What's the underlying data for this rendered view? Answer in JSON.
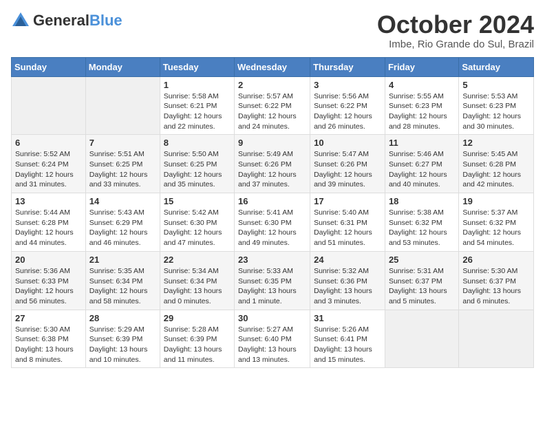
{
  "logo": {
    "text_general": "General",
    "text_blue": "Blue"
  },
  "header": {
    "month": "October 2024",
    "location": "Imbe, Rio Grande do Sul, Brazil"
  },
  "days_of_week": [
    "Sunday",
    "Monday",
    "Tuesday",
    "Wednesday",
    "Thursday",
    "Friday",
    "Saturday"
  ],
  "weeks": [
    [
      {
        "day": "",
        "info": ""
      },
      {
        "day": "",
        "info": ""
      },
      {
        "day": "1",
        "info": "Sunrise: 5:58 AM\nSunset: 6:21 PM\nDaylight: 12 hours and 22 minutes."
      },
      {
        "day": "2",
        "info": "Sunrise: 5:57 AM\nSunset: 6:22 PM\nDaylight: 12 hours and 24 minutes."
      },
      {
        "day": "3",
        "info": "Sunrise: 5:56 AM\nSunset: 6:22 PM\nDaylight: 12 hours and 26 minutes."
      },
      {
        "day": "4",
        "info": "Sunrise: 5:55 AM\nSunset: 6:23 PM\nDaylight: 12 hours and 28 minutes."
      },
      {
        "day": "5",
        "info": "Sunrise: 5:53 AM\nSunset: 6:23 PM\nDaylight: 12 hours and 30 minutes."
      }
    ],
    [
      {
        "day": "6",
        "info": "Sunrise: 5:52 AM\nSunset: 6:24 PM\nDaylight: 12 hours and 31 minutes."
      },
      {
        "day": "7",
        "info": "Sunrise: 5:51 AM\nSunset: 6:25 PM\nDaylight: 12 hours and 33 minutes."
      },
      {
        "day": "8",
        "info": "Sunrise: 5:50 AM\nSunset: 6:25 PM\nDaylight: 12 hours and 35 minutes."
      },
      {
        "day": "9",
        "info": "Sunrise: 5:49 AM\nSunset: 6:26 PM\nDaylight: 12 hours and 37 minutes."
      },
      {
        "day": "10",
        "info": "Sunrise: 5:47 AM\nSunset: 6:26 PM\nDaylight: 12 hours and 39 minutes."
      },
      {
        "day": "11",
        "info": "Sunrise: 5:46 AM\nSunset: 6:27 PM\nDaylight: 12 hours and 40 minutes."
      },
      {
        "day": "12",
        "info": "Sunrise: 5:45 AM\nSunset: 6:28 PM\nDaylight: 12 hours and 42 minutes."
      }
    ],
    [
      {
        "day": "13",
        "info": "Sunrise: 5:44 AM\nSunset: 6:28 PM\nDaylight: 12 hours and 44 minutes."
      },
      {
        "day": "14",
        "info": "Sunrise: 5:43 AM\nSunset: 6:29 PM\nDaylight: 12 hours and 46 minutes."
      },
      {
        "day": "15",
        "info": "Sunrise: 5:42 AM\nSunset: 6:30 PM\nDaylight: 12 hours and 47 minutes."
      },
      {
        "day": "16",
        "info": "Sunrise: 5:41 AM\nSunset: 6:30 PM\nDaylight: 12 hours and 49 minutes."
      },
      {
        "day": "17",
        "info": "Sunrise: 5:40 AM\nSunset: 6:31 PM\nDaylight: 12 hours and 51 minutes."
      },
      {
        "day": "18",
        "info": "Sunrise: 5:38 AM\nSunset: 6:32 PM\nDaylight: 12 hours and 53 minutes."
      },
      {
        "day": "19",
        "info": "Sunrise: 5:37 AM\nSunset: 6:32 PM\nDaylight: 12 hours and 54 minutes."
      }
    ],
    [
      {
        "day": "20",
        "info": "Sunrise: 5:36 AM\nSunset: 6:33 PM\nDaylight: 12 hours and 56 minutes."
      },
      {
        "day": "21",
        "info": "Sunrise: 5:35 AM\nSunset: 6:34 PM\nDaylight: 12 hours and 58 minutes."
      },
      {
        "day": "22",
        "info": "Sunrise: 5:34 AM\nSunset: 6:34 PM\nDaylight: 13 hours and 0 minutes."
      },
      {
        "day": "23",
        "info": "Sunrise: 5:33 AM\nSunset: 6:35 PM\nDaylight: 13 hours and 1 minute."
      },
      {
        "day": "24",
        "info": "Sunrise: 5:32 AM\nSunset: 6:36 PM\nDaylight: 13 hours and 3 minutes."
      },
      {
        "day": "25",
        "info": "Sunrise: 5:31 AM\nSunset: 6:37 PM\nDaylight: 13 hours and 5 minutes."
      },
      {
        "day": "26",
        "info": "Sunrise: 5:30 AM\nSunset: 6:37 PM\nDaylight: 13 hours and 6 minutes."
      }
    ],
    [
      {
        "day": "27",
        "info": "Sunrise: 5:30 AM\nSunset: 6:38 PM\nDaylight: 13 hours and 8 minutes."
      },
      {
        "day": "28",
        "info": "Sunrise: 5:29 AM\nSunset: 6:39 PM\nDaylight: 13 hours and 10 minutes."
      },
      {
        "day": "29",
        "info": "Sunrise: 5:28 AM\nSunset: 6:39 PM\nDaylight: 13 hours and 11 minutes."
      },
      {
        "day": "30",
        "info": "Sunrise: 5:27 AM\nSunset: 6:40 PM\nDaylight: 13 hours and 13 minutes."
      },
      {
        "day": "31",
        "info": "Sunrise: 5:26 AM\nSunset: 6:41 PM\nDaylight: 13 hours and 15 minutes."
      },
      {
        "day": "",
        "info": ""
      },
      {
        "day": "",
        "info": ""
      }
    ]
  ]
}
